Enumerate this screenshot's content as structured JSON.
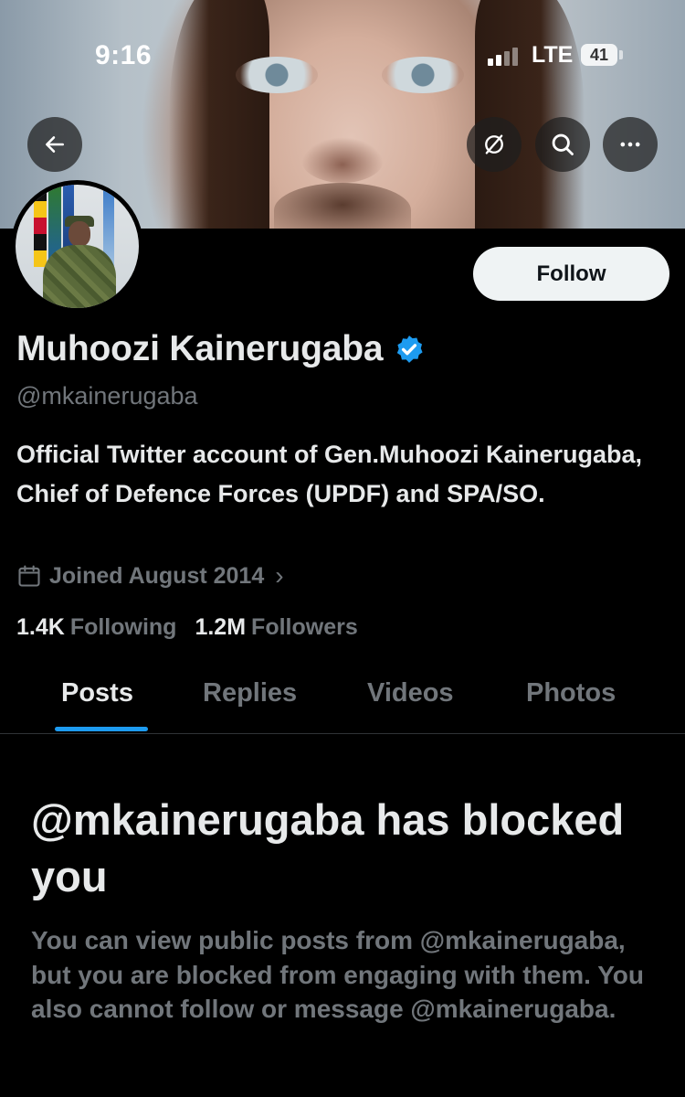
{
  "status_bar": {
    "time": "9:16",
    "network": "LTE",
    "battery": "41"
  },
  "header": {
    "banner_icon": "portrait-photo"
  },
  "profile": {
    "name": "Muhoozi Kainerugaba",
    "handle": "@mkainerugaba",
    "bio": "Official Twitter account of Gen.Muhoozi Kainerugaba, Chief of Defence Forces (UPDF) and SPA/SO.",
    "joined": "Joined August 2014",
    "following_count": "1.4K",
    "following_label": "Following",
    "followers_count": "1.2M",
    "followers_label": "Followers",
    "follow_button": "Follow",
    "verified_color": "#1d9bf0"
  },
  "tabs": [
    {
      "label": "Posts",
      "active": true
    },
    {
      "label": "Replies",
      "active": false
    },
    {
      "label": "Videos",
      "active": false
    },
    {
      "label": "Photos",
      "active": false
    }
  ],
  "blocked": {
    "title": "@mkainerugaba has blocked you",
    "message": "You can view public posts from @mkainerugaba, but you are blocked from engaging with them. You also cannot follow or message @mkainerugaba."
  },
  "colors": {
    "accent": "#1d9bf0",
    "background": "#000000",
    "muted_text": "#71767b"
  }
}
